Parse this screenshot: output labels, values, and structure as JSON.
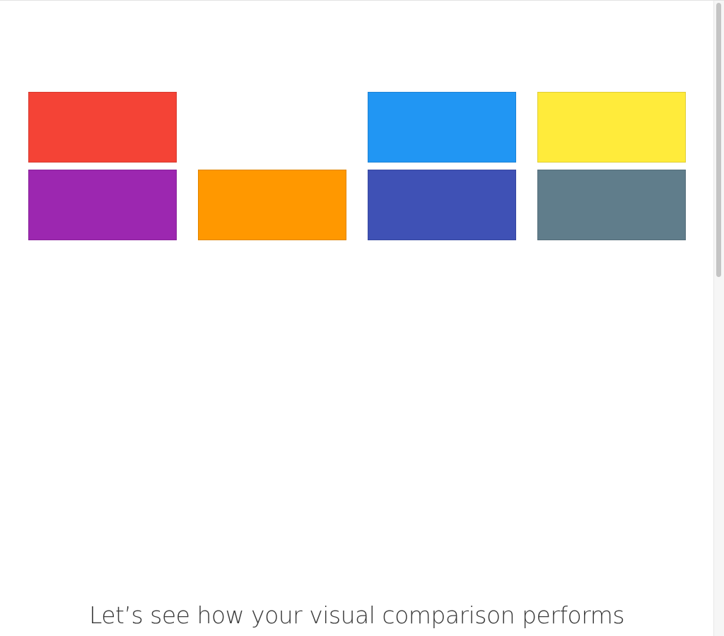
{
  "page": {
    "tagline": "Let’s see how your visual comparison performs"
  },
  "swatches": [
    {
      "name": "red-swatch",
      "color": "#F44336"
    },
    {
      "name": "blue-swatch",
      "color": "#2196F3"
    },
    {
      "name": "yellow-swatch",
      "color": "#FFEB3B"
    },
    {
      "name": "purple-swatch",
      "color": "#9C27B0"
    },
    {
      "name": "orange-swatch",
      "color": "#FF9800"
    },
    {
      "name": "indigo-swatch",
      "color": "#3F51B5"
    },
    {
      "name": "blue-grey-swatch",
      "color": "#607D8B"
    }
  ]
}
